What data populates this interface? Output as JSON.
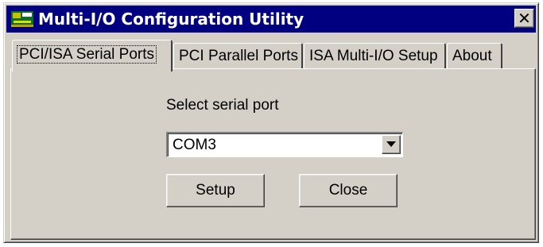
{
  "window": {
    "title": "Multi-I/O Configuration Utility",
    "close_glyph": "✕",
    "app_icon": "board-icon",
    "colors": {
      "titlebar": "#000080",
      "face": "#d4d0c8"
    }
  },
  "tabs": [
    {
      "label": "PCI/ISA Serial Ports",
      "active": true
    },
    {
      "label": "PCI Parallel Ports",
      "active": false
    },
    {
      "label": "ISA Multi-I/O Setup",
      "active": false
    },
    {
      "label": "About",
      "active": false
    }
  ],
  "panel": {
    "select_label": "Select serial port",
    "port_select": {
      "value": "COM3",
      "dropdown_icon": "triangle-down-icon"
    },
    "setup_button": "Setup",
    "close_button": "Close"
  }
}
